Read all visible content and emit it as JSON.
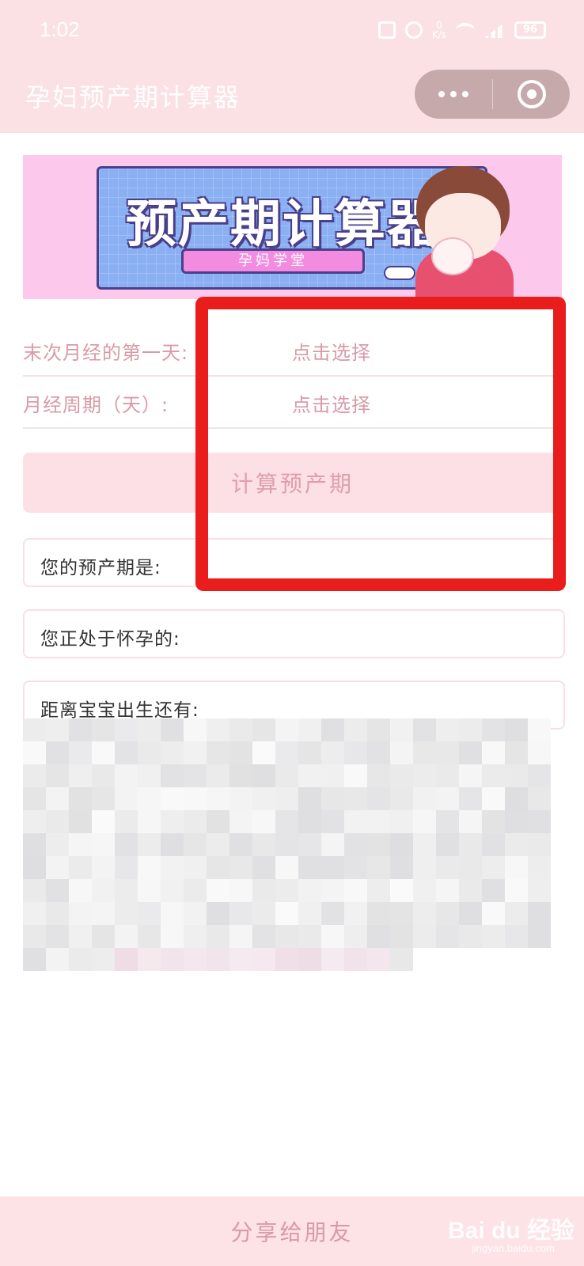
{
  "status_bar": {
    "time": "1:02",
    "net_speed": "0\nK/s",
    "battery": "96"
  },
  "title_bar": {
    "title": "孕妇预产期计算器"
  },
  "banner": {
    "title": "预产期计算器",
    "subtitle": "孕妈学堂"
  },
  "form": {
    "rows": [
      {
        "label": "末次月经的第一天:",
        "value": "点击选择"
      },
      {
        "label": "月经周期（天）:",
        "value": "点击选择"
      }
    ],
    "calc_button": "计算预产期"
  },
  "results": [
    {
      "label": "您的预产期是:"
    },
    {
      "label": "您正处于怀孕的:"
    },
    {
      "label": "距离宝宝出生还有:"
    }
  ],
  "footer": {
    "share_button": "分享给朋友"
  },
  "watermark": {
    "main": "Bai du 经验",
    "sub": "jingyan.baidu.com"
  },
  "colors": {
    "header_bg": "#fce1e4",
    "accent_text": "#d99aa7",
    "highlight_border": "#ea1d1d"
  }
}
